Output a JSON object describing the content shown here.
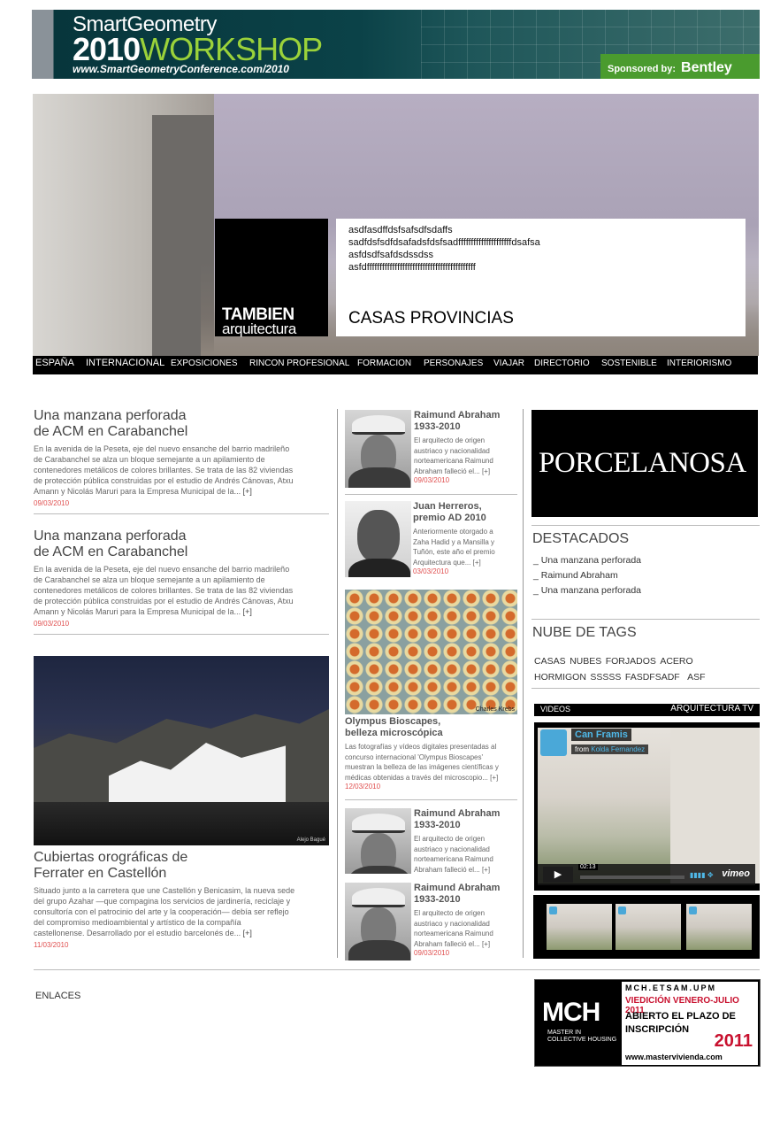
{
  "banner": {
    "line1": "SmartGeometry",
    "line2_year": "2010",
    "line2_word": "WORKSHOP",
    "url": "www.SmartGeometryConference.com/2010",
    "sponsor_label": "Sponsored by:",
    "sponsor_name": "Bentley"
  },
  "hero": {
    "logo_line1": "TAMBIEN",
    "logo_line2": "arquitectura",
    "lines": [
      "asdfasdffdsfsafsdfsdaffs",
      "sadfdsfsdfdsafadsfdsfsadfffffffffffffffffffffdsafsa",
      "asfdsdfsafdsdssdss",
      "asfdfffffffffffffffffffffffffffffffffffffffffff"
    ],
    "title": "CASAS PROVINCIAS"
  },
  "nav": [
    "ESPAÑA",
    "INTERNACIONAL",
    "EXPOSICIONES",
    "RINCON PROFESIONAL",
    "FORMACION",
    "PERSONAJES",
    "VIAJAR",
    "DIRECTORIO",
    "SOSTENIBLE",
    "INTERIORISMO"
  ],
  "left_articles": [
    {
      "title1": "Una manzana perforada",
      "title2": "de ACM en Carabanchel",
      "body": [
        "En la avenida de la Peseta, eje del nuevo ensanche del barrio madrileño",
        "de Carabanchel se alza un bloque semejante a un apilamiento de",
        "contenedores metálicos de colores brillantes. Se trata de las 82 viviendas",
        "de protección pública construidas por el estudio de Andrés Cánovas, Atxu",
        "Amann y Nicolás Maruri para la Empresa Municipal de la..."
      ],
      "more": "[+]",
      "date": "09/03/2010"
    },
    {
      "title1": "Una manzana perforada",
      "title2": "de ACM en Carabanchel",
      "body": [
        "En la avenida de la Peseta, eje del nuevo ensanche del barrio madrileño",
        "de Carabanchel se alza un bloque semejante a un apilamiento de",
        "contenedores metálicos de colores brillantes. Se trata de las 82 viviendas",
        "de protección pública construidas por el estudio de Andrés Cánovas, Atxu",
        "Amann y Nicolás Maruri para la Empresa Municipal de la..."
      ],
      "more": "[+]",
      "date": "09/03/2010"
    }
  ],
  "feature": {
    "photo_credit": "Alejo Bagué",
    "title1": "Cubiertas orográficas de",
    "title2": "Ferrater en Castellón",
    "body": [
      "Situado junto a la carretera que une Castellón y Benicasim, la nueva sede",
      "del grupo Azahar —que compagina los servicios de jardinería, reciclaje y",
      "consultoría con el patrocinio del arte y la cooperación— debía ser reflejo",
      "del compromiso medioambiental y artístico de la compañía",
      "castellonense. Desarrollado por el estudio barcelonés de..."
    ],
    "more": "[+]",
    "date": "11/03/2010"
  },
  "middle": {
    "items": [
      {
        "title1": "Raimund Abraham",
        "title2": "1933-2010",
        "body": [
          "El arquitecto de origen",
          "austriaco y nacionalidad",
          "norteamericana Raimund",
          "Abraham falleció el..."
        ],
        "more": "[+]",
        "date": "09/03/2010"
      },
      {
        "title1": "Juan Herreros,",
        "title2": "premio AD 2010",
        "body": [
          "Anteriormente otorgado a",
          "Zaha Hadid y a Mansilla y",
          "Tuñón, este año el premio",
          "Arquitectura que..."
        ],
        "more": "[+]",
        "date": "03/03/2010"
      }
    ],
    "bio": {
      "credit": "Charles Krebs",
      "title1": "Olympus Bioscapes,",
      "title2": "belleza microscópica",
      "body": [
        "Las fotografías y vídeos digitales presentadas al",
        "concurso internacional 'Olympus Bioscapes'",
        "muestran la belleza de las imágenes científicas y",
        "médicas obtenidas a través del microscopio..."
      ],
      "more": "[+]",
      "date": "12/03/2010"
    },
    "items2": [
      {
        "title1": "Raimund Abraham",
        "title2": "1933-2010",
        "body": [
          "El arquitecto de origen",
          "austriaco y nacionalidad",
          "norteamericana Raimund",
          "Abraham falleció el..."
        ],
        "more": "[+]",
        "date": ""
      },
      {
        "title1": "Raimund Abraham",
        "title2": "1933-2010",
        "body": [
          "El arquitecto de origen",
          "austriaco y nacionalidad",
          "norteamericana Raimund",
          "Abraham falleció el..."
        ],
        "more": "[+]",
        "date": "09/03/2010"
      }
    ]
  },
  "right": {
    "ad_brand": "PORCELANOSA",
    "destacados_title": "DESTACADOS",
    "destacados": [
      "_ Una manzana perforada",
      "_ Raimund Abraham",
      "_ Una manzana perforada"
    ],
    "tags_title": "NUBE DE TAGS",
    "tags_line1": [
      "CASAS",
      "NUBES",
      "FORJADOS",
      "ACERO"
    ],
    "tags_line2": [
      "HORMIGON",
      "SSSSS",
      "FASDFSADF",
      "ASF"
    ],
    "videos_label": "VIDEOS",
    "tv_label": "ARQUITECTURA TV",
    "video_title": "Can Framis",
    "video_from": "from",
    "video_author": "Kolda Fernandez",
    "video_time": "02:13",
    "video_brand": "vimeo"
  },
  "footer": {
    "enlaces": "ENLACES",
    "mch": {
      "big": "MCH",
      "sub1": "MASTER IN",
      "sub2": "COLLECTIVE HOUSING",
      "school": "MCH.ETSAM.UPM",
      "edition": "VIEDICIÓN VENERO-JULIO 2011",
      "line_a": "ABIERTO EL PLAZO DE",
      "line_b": "INSCRIPCIÓN",
      "year": "2011",
      "web": "www.mastervivienda.com"
    }
  },
  "colors": {
    "date": "#e05050",
    "video_accent": "#4fb8e8",
    "sponsor_green": "#4a9b2e",
    "mch_red": "#c8102e"
  }
}
